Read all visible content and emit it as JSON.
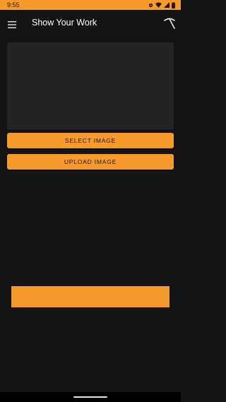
{
  "status_bar": {
    "time": "9:55",
    "icons": [
      "settings-dot-icon",
      "wifi-icon",
      "signal-icon",
      "battery-icon"
    ],
    "background": "#f7992b"
  },
  "app_bar": {
    "title": "Show Your Work",
    "menu_icon": "hamburger-menu-icon",
    "action_icon": "pickaxe-icon"
  },
  "main": {
    "image_preview": {
      "state": "empty"
    },
    "select_button_label": "SELECT IMAGE",
    "upload_button_label": "UPLOAD IMAGE"
  },
  "colors": {
    "accent": "#f7992b",
    "background": "#141414",
    "preview_background": "#242424",
    "text_on_accent": "#1a1a1a",
    "text_primary": "#ffffff"
  }
}
